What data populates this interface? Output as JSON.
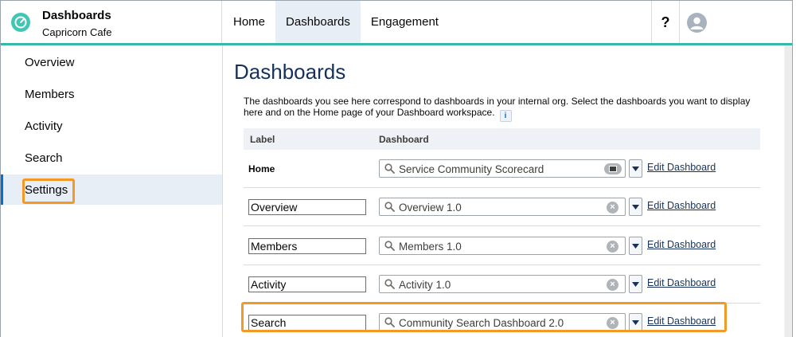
{
  "brand": {
    "title": "Dashboards",
    "subtitle": "Capricorn Cafe"
  },
  "nav": {
    "tabs": [
      {
        "label": "Home"
      },
      {
        "label": "Dashboards"
      },
      {
        "label": "Engagement"
      }
    ],
    "active_tab": "Dashboards",
    "help_label": "?"
  },
  "sidebar": {
    "items": [
      {
        "label": "Overview"
      },
      {
        "label": "Members"
      },
      {
        "label": "Activity"
      },
      {
        "label": "Search"
      },
      {
        "label": "Settings"
      }
    ],
    "active_item": "Settings"
  },
  "main": {
    "title": "Dashboards",
    "description": "The dashboards you see here correspond to dashboards in your internal org. Select the dashboards you want to display here and on the Home page of your Dashboard workspace.",
    "info_icon_glyph": "i",
    "table": {
      "headers": {
        "label": "Label",
        "dashboard": "Dashboard"
      },
      "edit_link_label": "Edit Dashboard",
      "rows": [
        {
          "label": "Home",
          "dashboard": "Service Community Scorecard"
        },
        {
          "label": "Overview",
          "dashboard": "Overview 1.0"
        },
        {
          "label": "Members",
          "dashboard": "Members 1.0"
        },
        {
          "label": "Activity",
          "dashboard": "Activity 1.0"
        },
        {
          "label": "Search",
          "dashboard": "Community Search Dashboard 2.0"
        }
      ]
    }
  },
  "colors": {
    "accent_teal": "#35b8a6",
    "highlight_orange": "#f39a26",
    "active_blue": "#0070d2",
    "title_navy": "#16325c"
  }
}
